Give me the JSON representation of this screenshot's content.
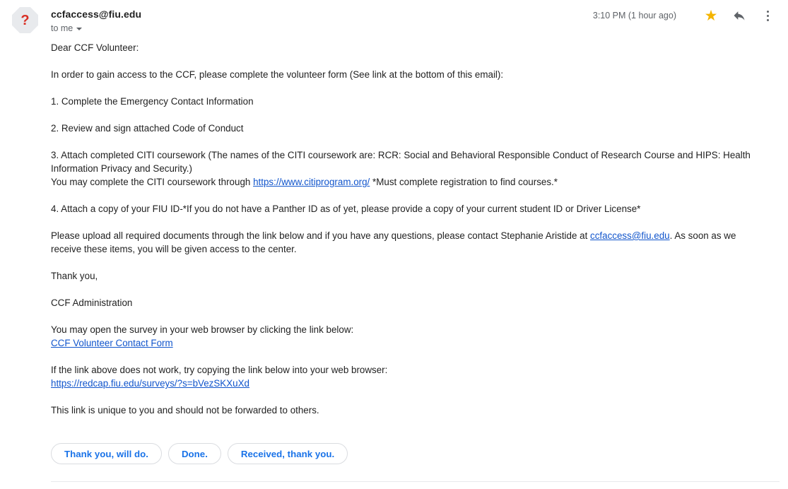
{
  "message": {
    "avatar": {
      "glyph": "?",
      "shape": "octagon",
      "bg_color": "#e8eaed",
      "glyph_color": "#d93025",
      "icon_name": "unknown-sender-avatar"
    },
    "sender": "ccfaccess@fiu.edu",
    "recipient": "to me",
    "timestamp": "3:10 PM (1 hour ago)",
    "actions": {
      "star": {
        "icon": "star-icon",
        "state": "starred",
        "color": "#f4b400"
      },
      "reply": {
        "icon": "reply-arrow-icon",
        "color": "#5f6368"
      },
      "more": {
        "icon": "more-vertical-icon",
        "color": "#5f6368"
      }
    },
    "body": {
      "p1": "Dear CCF Volunteer:",
      "p2": "In order to gain access to the CCF, please complete the volunteer form (See link at the bottom of this email):",
      "p3": "1. Complete the Emergency Contact Information",
      "p4": "2. Review and sign attached Code of Conduct",
      "p5_line1": "3. Attach completed CITI coursework (The names of the CITI coursework are: RCR: Social and Behavioral Responsible Conduct of Research Course and HIPS: Health Information Privacy and Security.)",
      "p5_line2_pre": "You may complete the CITI coursework through ",
      "p5_link_text": "https://www.citiprogram.org/",
      "p5_line2_post": " *Must complete registration to find courses.*",
      "p6": "4. Attach a copy of your FIU ID-*If you do not have a Panther ID as of yet, please provide a copy of your current student ID or Driver License*",
      "p7_pre": "Please upload all required documents through the link below and if you have any questions, please contact Stephanie Aristide at ",
      "p7_link_text": "ccfaccess@fiu.edu",
      "p7_post": ". As soon as we receive these items, you will be given access to the center.",
      "p8": "Thank you,",
      "p9": "CCF Administration",
      "p10": "You may open the survey in your web browser by clicking the link below:",
      "p10_link_text": "CCF Volunteer Contact Form",
      "p11": "If the link above does not work, try copying the link below into your web browser:",
      "p11_link_text": "https://redcap.fiu.edu/surveys/?s=bVezSKXuXd",
      "p12": "This link is unique to you and should not be forwarded to others."
    },
    "link_color": "#1155cc"
  },
  "smart_replies": {
    "chips": [
      {
        "label": "Thank you, will do."
      },
      {
        "label": "Done."
      },
      {
        "label": "Received, thank you."
      }
    ],
    "text_color": "#1a73e8",
    "border_color": "#dadce0"
  }
}
